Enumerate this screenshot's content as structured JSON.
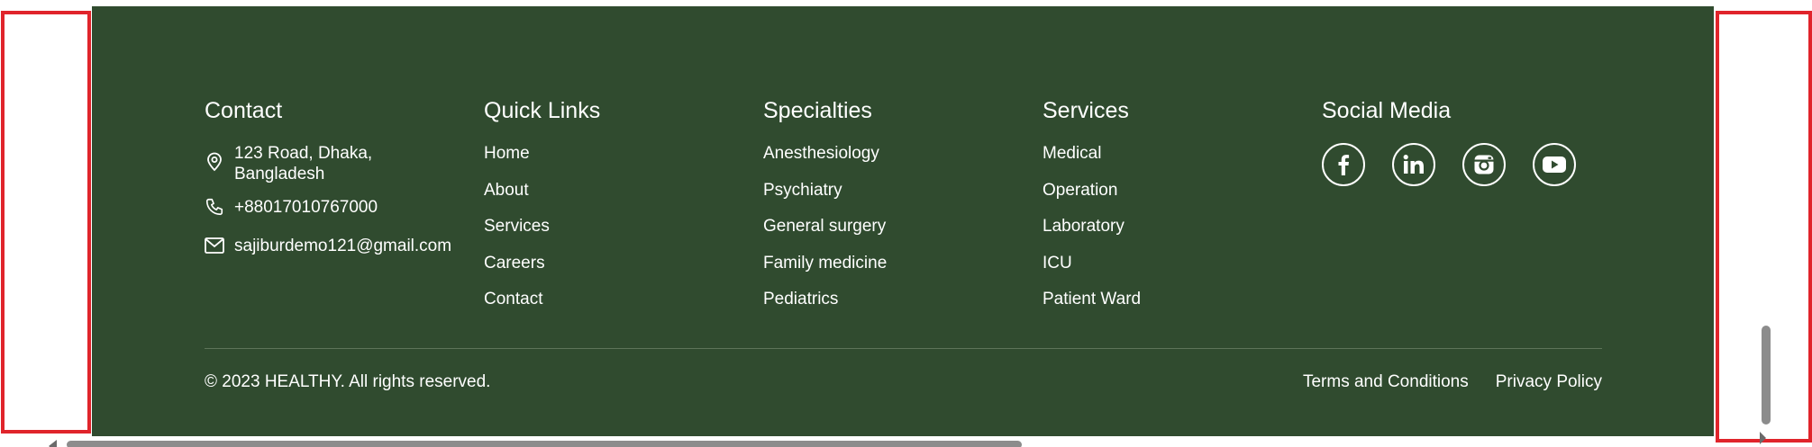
{
  "footer": {
    "contact": {
      "title": "Contact",
      "address_line1": "123 Road, Dhaka,",
      "address_line2": "Bangladesh",
      "phone": "+88017010767000",
      "email": "sajiburdemo121@gmail.com"
    },
    "quick_links": {
      "title": "Quick Links",
      "items": [
        "Home",
        "About",
        "Services",
        "Careers",
        "Contact"
      ]
    },
    "specialties": {
      "title": "Specialties",
      "items": [
        "Anesthesiology",
        "Psychiatry",
        "General surgery",
        "Family medicine",
        "Pediatrics"
      ]
    },
    "services": {
      "title": "Services",
      "items": [
        "Medical",
        "Operation",
        "Laboratory",
        "ICU",
        "Patient Ward"
      ]
    },
    "social": {
      "title": "Social Media",
      "icons": [
        "facebook-icon",
        "linkedin-icon",
        "instagram-icon",
        "youtube-icon"
      ]
    },
    "copyright": "© 2023 HEALTHY. All rights reserved.",
    "terms": "Terms and Conditions",
    "privacy": "Privacy Policy"
  },
  "colors": {
    "footer_bg": "#304b2f",
    "highlight": "#e0242b",
    "text": "#ffffff"
  }
}
